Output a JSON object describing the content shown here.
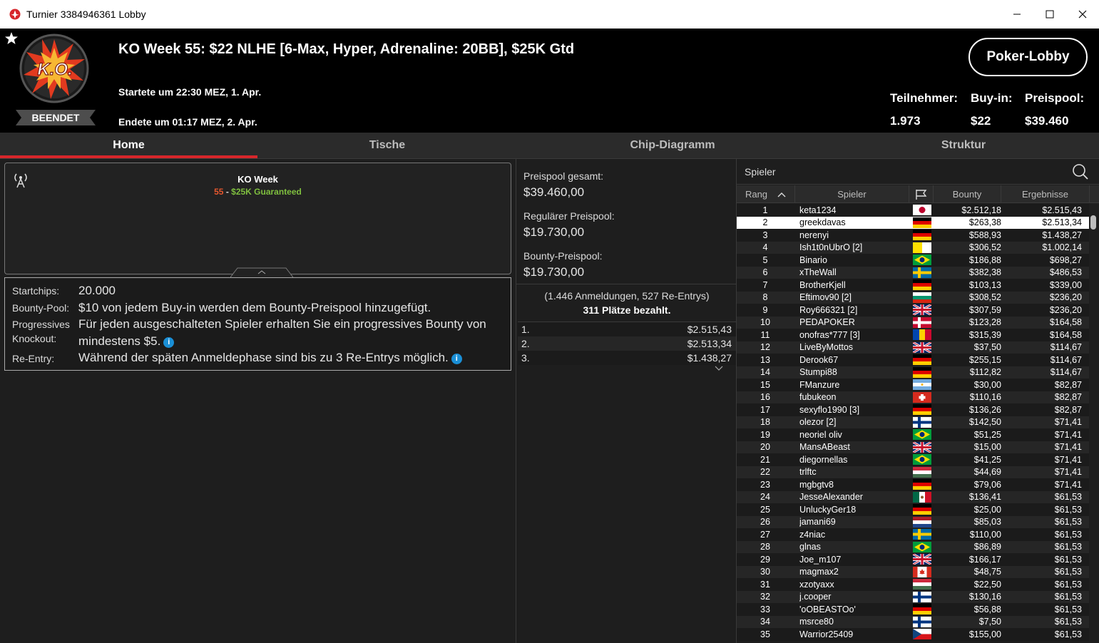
{
  "window": {
    "title": "Turnier 3384946361 Lobby"
  },
  "header": {
    "logo_text": "K.O.",
    "status": "BEENDET",
    "title": "KO Week 55: $22 NLHE [6-Max, Hyper, Adrenaline: 20BB], $25K Gtd",
    "started": "Startete um 22:30 MEZ, 1. Apr.",
    "ended": "Endete um 01:17 MEZ, 2. Apr.",
    "lobby_button": "Poker-Lobby",
    "stats": {
      "participants_label": "Teilnehmer:",
      "participants": "1.973",
      "buyin_label": "Buy-in:",
      "buyin": "$22",
      "prizepool_label": "Preispool:",
      "prizepool": "$39.460"
    }
  },
  "tabs": [
    {
      "label": "Home",
      "active": true
    },
    {
      "label": "Tische",
      "active": false
    },
    {
      "label": "Chip-Diagramm",
      "active": false
    },
    {
      "label": "Struktur",
      "active": false
    }
  ],
  "info_card": {
    "name": "KO Week",
    "number": "55",
    "separator": " - ",
    "guarantee": "$25K Guaranteed"
  },
  "details": {
    "startchips_label": "Startchips:",
    "startchips": "20.000",
    "bountypool_label": "Bounty-Pool:",
    "bountypool": "$10 von jedem Buy-in werden dem Bounty-Preispool hinzugefügt.",
    "progressive_label_1": "Progressives",
    "progressive_label_2": "Knockout:",
    "progressive_line1": "Für jeden ausgeschalteten Spieler erhalten Sie ein progressives Bounty von",
    "progressive_line2": "mindestens $5.",
    "reentry_label": "Re-Entry:",
    "reentry": "Während der späten Anmeldephase sind bis zu 3 Re-Entrys möglich."
  },
  "prizepool": {
    "total_label": "Preispool gesamt:",
    "total": "$39.460,00",
    "regular_label": "Regulärer Preispool:",
    "regular": "$19.730,00",
    "bounty_label": "Bounty-Preispool:",
    "bounty": "$19.730,00",
    "registrations": "(1.446 Anmeldungen, 527 Re-Entrys)",
    "paid": "311 Plätze bezahlt.",
    "payouts": [
      {
        "place": "1.",
        "amount": "$2.515,43"
      },
      {
        "place": "2.",
        "amount": "$2.513,34"
      },
      {
        "place": "3.",
        "amount": "$1.438,27"
      }
    ]
  },
  "players": {
    "search_placeholder": "Spieler",
    "headers": {
      "rank": "Rang",
      "player": "Spieler",
      "bounty": "Bounty",
      "result": "Ergebnisse"
    },
    "rows": [
      {
        "rank": "1",
        "name": "keta1234",
        "flag": "jp",
        "bounty": "$2.512,18",
        "result": "$2.515,43"
      },
      {
        "rank": "2",
        "name": "greekdavas",
        "flag": "de",
        "bounty": "$263,38",
        "result": "$2.513,34",
        "selected": true
      },
      {
        "rank": "3",
        "name": "nerenyi",
        "flag": "de",
        "bounty": "$588,93",
        "result": "$1.438,27"
      },
      {
        "rank": "4",
        "name": "Ish1t0nUbrO [2]",
        "flag": "va",
        "bounty": "$306,52",
        "result": "$1.002,14"
      },
      {
        "rank": "5",
        "name": "Binario",
        "flag": "br",
        "bounty": "$186,88",
        "result": "$698,27"
      },
      {
        "rank": "6",
        "name": "xTheWall",
        "flag": "se",
        "bounty": "$382,38",
        "result": "$486,53"
      },
      {
        "rank": "7",
        "name": "BrotherKjell",
        "flag": "de",
        "bounty": "$103,13",
        "result": "$339,00"
      },
      {
        "rank": "8",
        "name": "Eftimov90 [2]",
        "flag": "bg",
        "bounty": "$308,52",
        "result": "$236,20"
      },
      {
        "rank": "9",
        "name": "Roy666321 [2]",
        "flag": "gb",
        "bounty": "$307,59",
        "result": "$236,20"
      },
      {
        "rank": "10",
        "name": "PEDAPOKER",
        "flag": "dk",
        "bounty": "$123,28",
        "result": "$164,58"
      },
      {
        "rank": "11",
        "name": "onofras*777 [3]",
        "flag": "md",
        "bounty": "$315,39",
        "result": "$164,58"
      },
      {
        "rank": "12",
        "name": "LiveByMottos",
        "flag": "gb",
        "bounty": "$37,50",
        "result": "$114,67"
      },
      {
        "rank": "13",
        "name": "Derook67",
        "flag": "de",
        "bounty": "$255,15",
        "result": "$114,67"
      },
      {
        "rank": "14",
        "name": "Stumpi88",
        "flag": "de",
        "bounty": "$112,82",
        "result": "$114,67"
      },
      {
        "rank": "15",
        "name": "FManzure",
        "flag": "ar",
        "bounty": "$30,00",
        "result": "$82,87"
      },
      {
        "rank": "16",
        "name": "fubukeon",
        "flag": "ch",
        "bounty": "$110,16",
        "result": "$82,87"
      },
      {
        "rank": "17",
        "name": "sexyflo1990 [3]",
        "flag": "de",
        "bounty": "$136,26",
        "result": "$82,87"
      },
      {
        "rank": "18",
        "name": "olezor [2]",
        "flag": "fi",
        "bounty": "$142,50",
        "result": "$71,41"
      },
      {
        "rank": "19",
        "name": "neoriel oliv",
        "flag": "br",
        "bounty": "$51,25",
        "result": "$71,41"
      },
      {
        "rank": "20",
        "name": "MansABeast",
        "flag": "gb",
        "bounty": "$15,00",
        "result": "$71,41"
      },
      {
        "rank": "21",
        "name": "diegornellas",
        "flag": "br",
        "bounty": "$41,25",
        "result": "$71,41"
      },
      {
        "rank": "22",
        "name": "trlftc",
        "flag": "hu",
        "bounty": "$44,69",
        "result": "$71,41"
      },
      {
        "rank": "23",
        "name": "mgbgtv8",
        "flag": "de",
        "bounty": "$79,06",
        "result": "$71,41"
      },
      {
        "rank": "24",
        "name": "JesseAlexander",
        "flag": "mx",
        "bounty": "$136,41",
        "result": "$61,53"
      },
      {
        "rank": "25",
        "name": "UnluckyGer18",
        "flag": "de",
        "bounty": "$25,00",
        "result": "$61,53"
      },
      {
        "rank": "26",
        "name": "jamani69",
        "flag": "nl",
        "bounty": "$85,03",
        "result": "$61,53"
      },
      {
        "rank": "27",
        "name": "z4niac",
        "flag": "se",
        "bounty": "$110,00",
        "result": "$61,53"
      },
      {
        "rank": "28",
        "name": "glnas",
        "flag": "br",
        "bounty": "$86,89",
        "result": "$61,53"
      },
      {
        "rank": "29",
        "name": "Joe_m107",
        "flag": "gb",
        "bounty": "$166,17",
        "result": "$61,53"
      },
      {
        "rank": "30",
        "name": "magmax2",
        "flag": "ca",
        "bounty": "$48,75",
        "result": "$61,53"
      },
      {
        "rank": "31",
        "name": "xzotyaxx",
        "flag": "hu",
        "bounty": "$22,50",
        "result": "$61,53"
      },
      {
        "rank": "32",
        "name": "j.cooper",
        "flag": "fi",
        "bounty": "$130,16",
        "result": "$61,53"
      },
      {
        "rank": "33",
        "name": "'oOBEASTOo'",
        "flag": "de",
        "bounty": "$56,88",
        "result": "$61,53"
      },
      {
        "rank": "34",
        "name": "msrce80",
        "flag": "fi",
        "bounty": "$7,50",
        "result": "$61,53"
      },
      {
        "rank": "35",
        "name": "Warrior25409",
        "flag": "cz",
        "bounty": "$155,00",
        "result": "$61,53"
      }
    ]
  },
  "colors": {
    "accent_red": "#d7262b",
    "guarantee_green": "#7fbf3f",
    "number_orange": "#e4572e",
    "info_blue": "#1a8fd6"
  }
}
